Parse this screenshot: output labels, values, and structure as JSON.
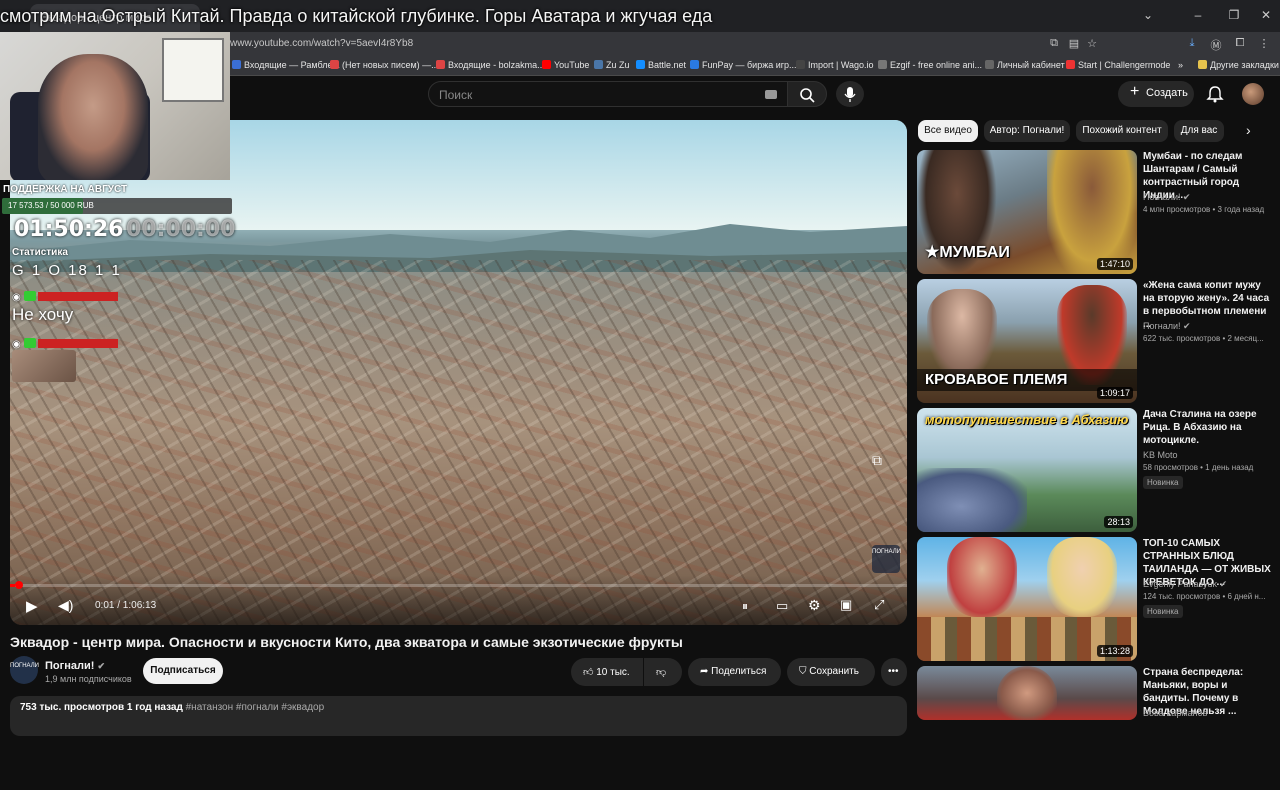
{
  "browser": {
    "tab_title": "Эквадор - центр мира...",
    "url": "www.youtube.com/watch?v=5aevI4r8Yb8",
    "bookmarks": [
      {
        "label": "Входящие — Рамбле...",
        "color": "#3b6fd6"
      },
      {
        "label": "(Нет новых писем) —...",
        "color": "#d44"
      },
      {
        "label": "Входящие - bolzakma...",
        "color": "#d44"
      },
      {
        "label": "YouTube",
        "color": "#f00"
      },
      {
        "label": "Zu Zu",
        "color": "#4a76a8"
      },
      {
        "label": "Battle.net",
        "color": "#148eff"
      },
      {
        "label": "FunPay — биржа игр...",
        "color": "#2a7ae2"
      },
      {
        "label": "Import | Wago.io",
        "color": "#444"
      },
      {
        "label": "Ezgif - free online ani...",
        "color": "#777"
      },
      {
        "label": "Личный кабинет",
        "color": "#666"
      },
      {
        "label": "Start | Challengermode",
        "color": "#e33"
      },
      {
        "label": "Другие закладки",
        "color": "#e6c34d"
      }
    ]
  },
  "stream": {
    "title": "смотрим на Острый Китай. Правда о китайской глубинке. Горы Аватара и жгучая еда",
    "donation_label": "ПОДДЕРЖКА НА АВГУСТ",
    "donation_text": "17 573.53 / 50 000 RUB",
    "donation_progress": 0.35,
    "timer_left": "01:50:26",
    "timer_right": "00:00:00",
    "stats_label": "Статистика",
    "stats_values": "G 1 O 18 1 1",
    "chat_user_1": "",
    "chat_user_2": "",
    "chat_message": "Не хочу"
  },
  "header": {
    "search_placeholder": "Поиск",
    "create_label": "Создать"
  },
  "player": {
    "time": "0:01 / 1:06:13",
    "progress": 0.001,
    "watermark": "ПОГНАЛИ"
  },
  "video": {
    "title": "Эквадор - центр мира. Опасности и вкусности Кито, два экватора и самые экзотические фрукты",
    "channel_name": "Погнали!",
    "channel_avatar_text": "ПОГНАЛИ",
    "subscribers": "1,9 млн подписчиков",
    "subscribe_label": "Подписаться",
    "likes": "10 тыс.",
    "share_label": "Поделиться",
    "save_label": "Сохранить",
    "views_date": "753 тыс. просмотров  1 год назад",
    "tags": "#натанзон #погнали #эквадор"
  },
  "chips": [
    "Все видео",
    "Автор: Погнали!",
    "Похожий контент",
    "Для вас"
  ],
  "recommendations": [
    {
      "title": "Мумбаи - по следам Шантарам / Самый контрастный город Индии ...",
      "channel": "Погнали!",
      "meta": "4 млн просмотров • 3 года назад",
      "duration": "1:47:10",
      "thumb_text": "★МУМБАИ",
      "badge": ""
    },
    {
      "title": "«Жена сама копит мужу на вторую жену». 24 часа в первобытном племени ...",
      "channel": "Погнали!",
      "meta": "622 тыс. просмотров • 2 месяц...",
      "duration": "1:09:17",
      "thumb_text": "КРОВАВОЕ ПЛЕМЯ",
      "badge": ""
    },
    {
      "title": "Дача Сталина на озере Рица. В Абхазию на мотоцикле.",
      "channel": "KB Moto",
      "meta": "58 просмотров • 1 день назад",
      "duration": "28:13",
      "thumb_text": "мотопутешествие в Абхазию",
      "badge": "Новинка"
    },
    {
      "title": "ТОП-10 САМЫХ СТРАННЫХ БЛЮД ТАИЛАНДА — ОТ ЖИВЫХ КРЕВЕТОК ДО ...",
      "channel": "Evgeniy Panasyuk",
      "meta": "124 тыс. просмотров • 6 дней н...",
      "duration": "1:13:28",
      "thumb_text": "",
      "badge": "Новинка"
    },
    {
      "title": "Страна беспредела: Маньяки, воры и бандиты. Почему в Молдове нельзя ...",
      "channel": "Вова Карманов",
      "meta": "",
      "duration": "",
      "thumb_text": "",
      "badge": ""
    }
  ],
  "colors": {
    "background": "#0f0f0f",
    "accent": "#ff0000",
    "chip_bg": "#272727"
  }
}
